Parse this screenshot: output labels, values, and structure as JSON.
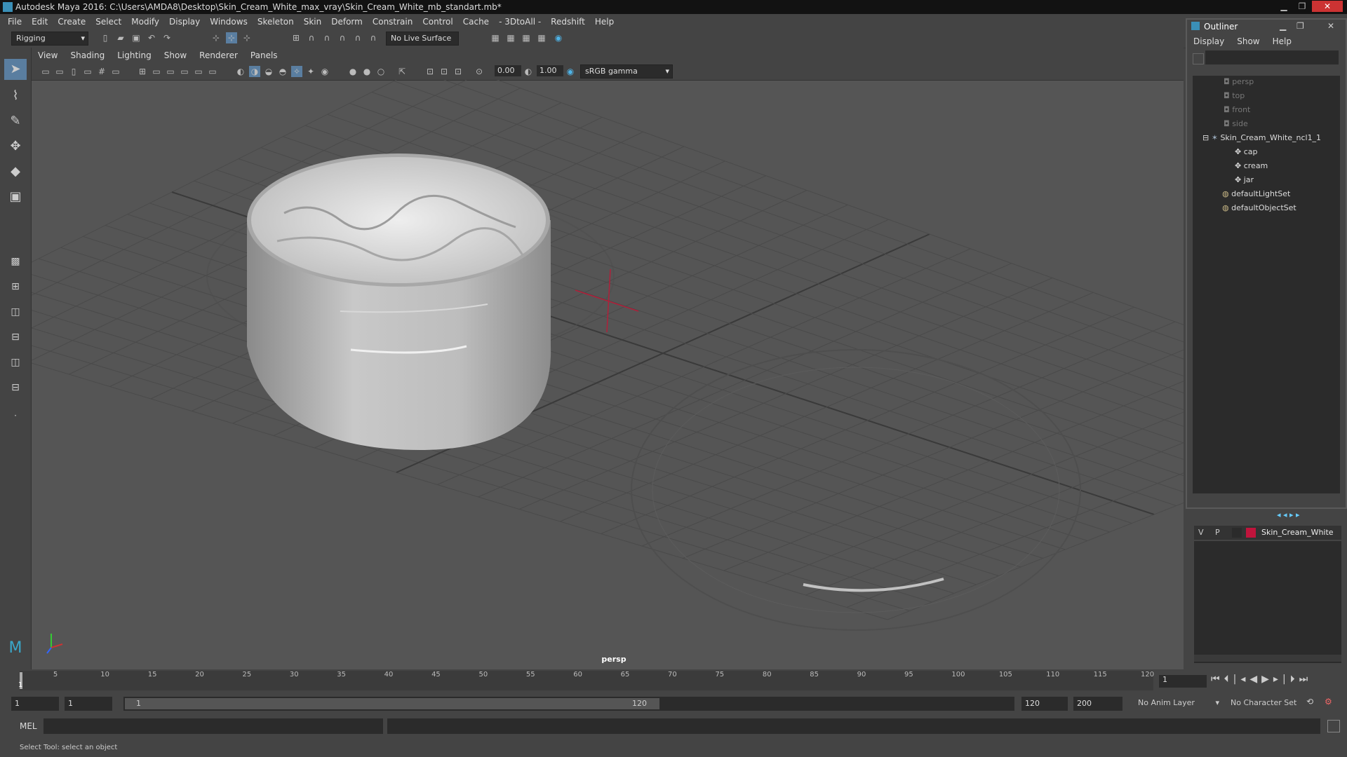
{
  "window": {
    "title": "Autodesk Maya 2016: C:\\Users\\AMDA8\\Desktop\\Skin_Cream_White_max_vray\\Skin_Cream_White_mb_standart.mb*"
  },
  "menubar": [
    "File",
    "Edit",
    "Create",
    "Select",
    "Modify",
    "Display",
    "Windows",
    "Skeleton",
    "Skin",
    "Deform",
    "Constrain",
    "Control",
    "Cache",
    "- 3DtoAll -",
    "Redshift",
    "Help"
  ],
  "shelf": {
    "mode": "Rigging",
    "live_surface": "No Live Surface"
  },
  "panel": {
    "menus": [
      "View",
      "Shading",
      "Lighting",
      "Show",
      "Renderer",
      "Panels"
    ],
    "exposure": "0.00",
    "gamma": "1.00",
    "color_space": "sRGB gamma",
    "camera_label": "persp"
  },
  "outliner": {
    "title": "Outliner",
    "menus": [
      "Display",
      "Show",
      "Help"
    ],
    "cameras": [
      "persp",
      "top",
      "front",
      "side"
    ],
    "group": "Skin_Cream_White_ncl1_1",
    "children": [
      "cap",
      "cream",
      "jar"
    ],
    "sets": [
      "defaultLightSet",
      "defaultObjectSet"
    ]
  },
  "layers": {
    "v": "V",
    "p": "P",
    "layer_name": "Skin_Cream_White",
    "layer_color": "#c0143c"
  },
  "timeline": {
    "ticks": [
      "5",
      "10",
      "15",
      "20",
      "25",
      "30",
      "35",
      "40",
      "45",
      "50",
      "55",
      "60",
      "65",
      "70",
      "75",
      "80",
      "85",
      "90",
      "95",
      "100",
      "105",
      "110",
      "115",
      "120"
    ],
    "start_tick": "1",
    "current_frame": "1"
  },
  "range": {
    "start": "1",
    "playback_start": "1",
    "range_start": "1",
    "range_end": "120",
    "playback_end": "120",
    "end": "200",
    "anim_layer": "No Anim Layer",
    "char_set": "No Character Set"
  },
  "cmdline": {
    "lang": "MEL"
  },
  "helpline": {
    "text": "Select Tool: select an object"
  }
}
